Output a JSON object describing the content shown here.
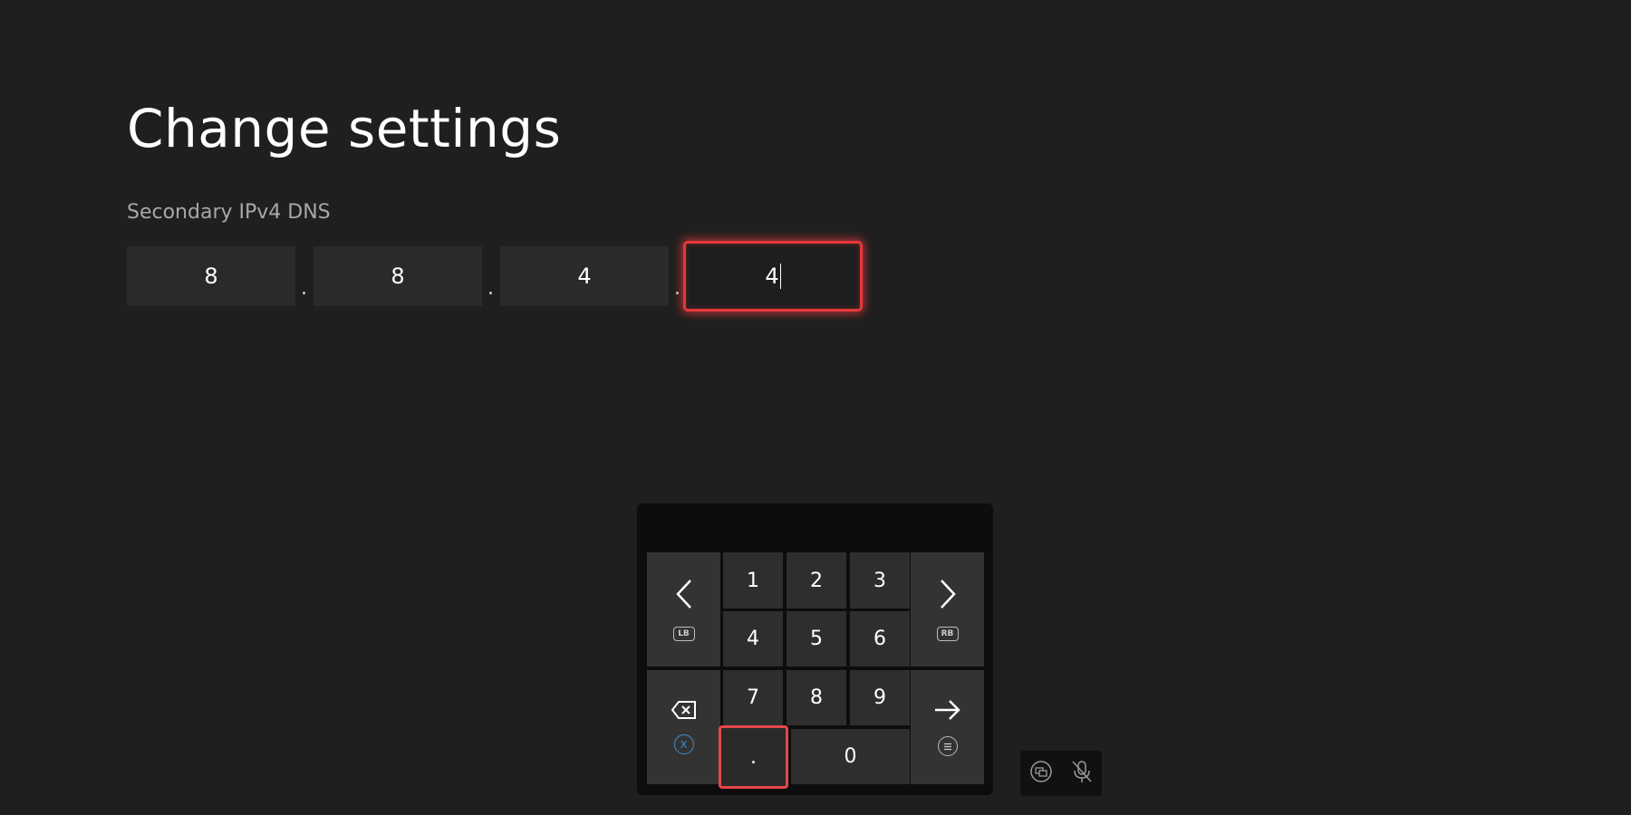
{
  "page": {
    "title": "Change settings"
  },
  "field": {
    "label": "Secondary IPv4 DNS",
    "octets": [
      "8",
      "8",
      "4",
      "4"
    ],
    "separator": "."
  },
  "keypad": {
    "keys": [
      "1",
      "2",
      "3",
      "4",
      "5",
      "6",
      "7",
      "8",
      "9",
      ".",
      "0"
    ],
    "left_hint": "LB",
    "right_hint": "RB",
    "backspace_hint": "X",
    "accent_focus": "#e5383b",
    "accent_x_button": "#3b8fd8"
  },
  "icons": {
    "left": "chevron-left-icon",
    "right": "chevron-right-icon",
    "backspace": "backspace-icon",
    "enter": "arrow-right-icon",
    "menu": "menu-button-icon",
    "view": "view-button-icon",
    "mic": "mic-off-icon"
  }
}
